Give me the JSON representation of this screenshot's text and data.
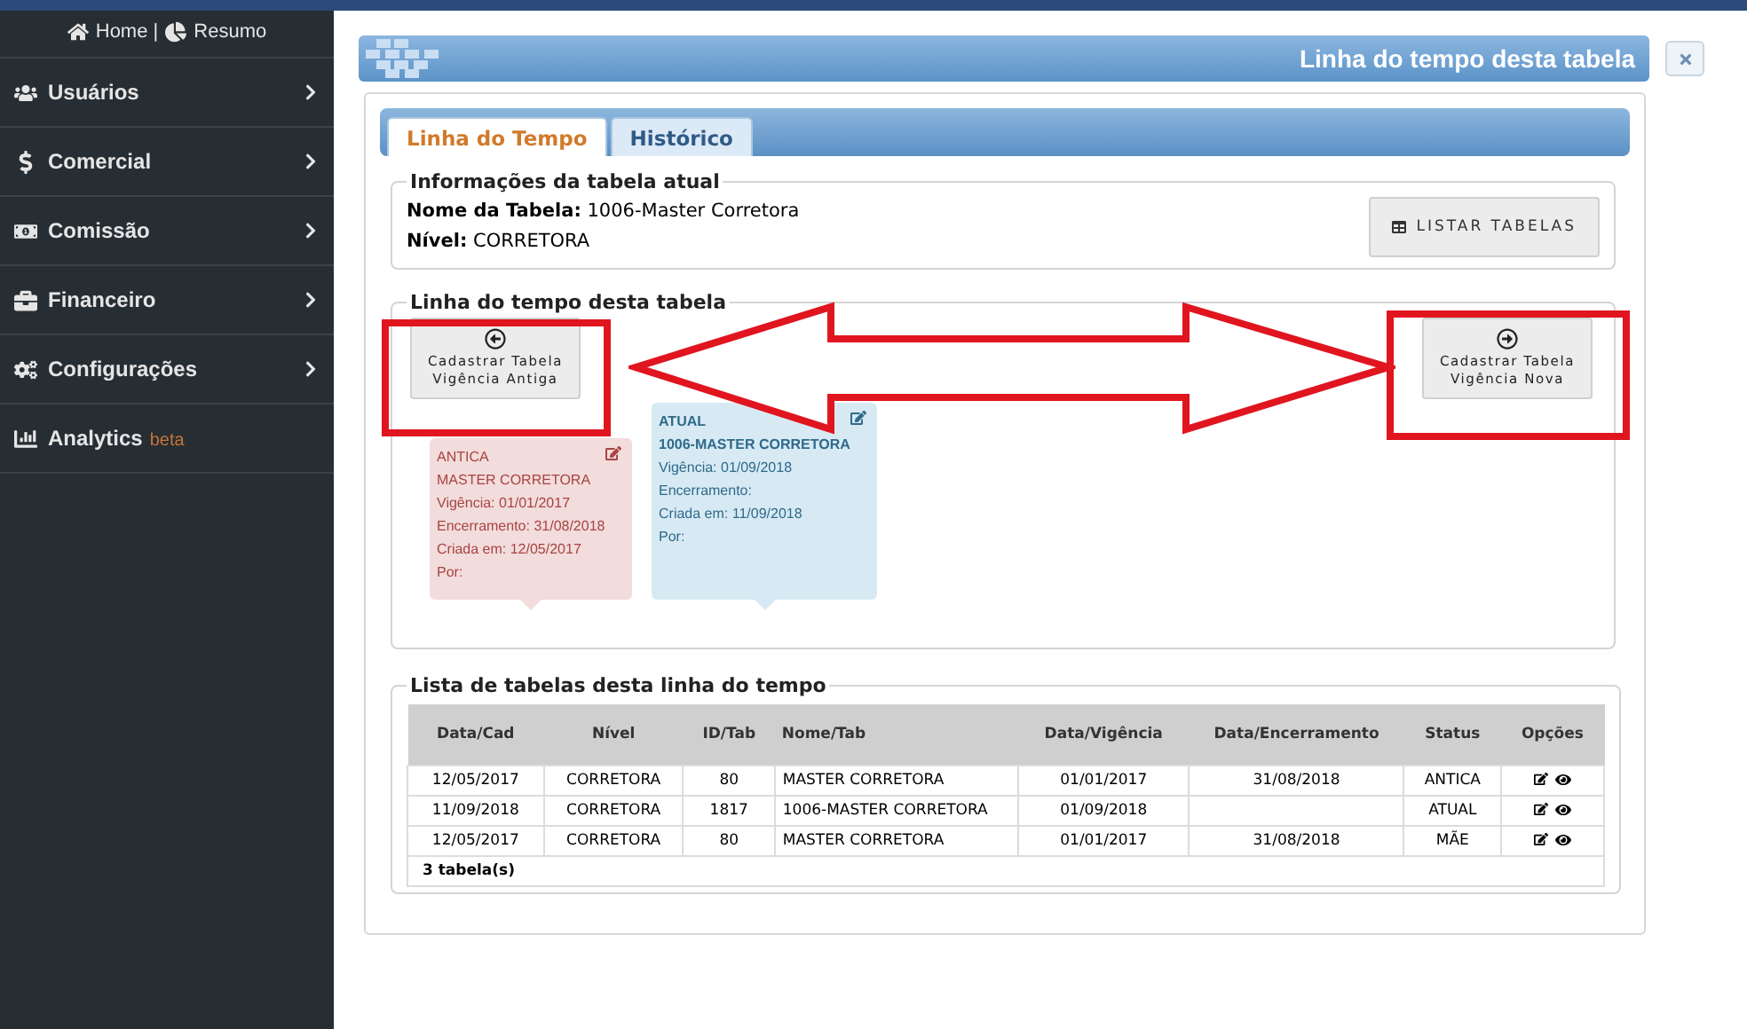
{
  "sidebar": {
    "header": {
      "home": "Home |",
      "summary": "Resumo"
    },
    "items": [
      {
        "label": "Usuários",
        "expandable": true
      },
      {
        "label": "Comercial",
        "expandable": true
      },
      {
        "label": "Comissão",
        "expandable": true
      },
      {
        "label": "Financeiro",
        "expandable": true
      },
      {
        "label": "Configurações",
        "expandable": true
      },
      {
        "label": "Analytics",
        "badge": "beta",
        "expandable": false
      }
    ]
  },
  "dialog": {
    "title": "Linha do tempo desta tabela",
    "tabs": [
      {
        "label": "Linha do Tempo",
        "selected": true
      },
      {
        "label": "Histórico",
        "selected": false
      }
    ],
    "info": {
      "legend": "Informações da tabela atual",
      "fields": [
        {
          "label": "Nome da Tabela:",
          "value": "1006-Master Corretora"
        },
        {
          "label": "Nível:",
          "value": "CORRETORA"
        }
      ],
      "button": "LISTAR TABELAS"
    },
    "timeline": {
      "legend": "Linha do tempo desta tabela",
      "button_old": "Cadastrar Tabela Vigência Antiga",
      "button_new": "Cadastrar Tabela Vigência Nova",
      "cards": [
        {
          "kind": "antiga",
          "lines": [
            "ANTICA",
            "MASTER CORRETORA",
            "Vigência: 01/01/2017",
            "Encerramento: 31/08/2018",
            "Criada em: 12/05/2017",
            "Por:"
          ]
        },
        {
          "kind": "atual",
          "lines": [
            "ATUAL",
            "1006-MASTER CORRETORA",
            "Vigência: 01/09/2018",
            "Encerramento:",
            "Criada em: 11/09/2018",
            "Por:"
          ]
        }
      ]
    },
    "list": {
      "legend": "Lista de tabelas desta linha do tempo",
      "columns": [
        "Data/Cad",
        "Nível",
        "ID/Tab",
        "Nome/Tab",
        "Data/Vigência",
        "Data/Encerramento",
        "Status",
        "Opções"
      ],
      "rows": [
        [
          "12/05/2017",
          "CORRETORA",
          "80",
          "MASTER CORRETORA",
          "01/01/2017",
          "31/08/2018",
          "ANTICA"
        ],
        [
          "11/09/2018",
          "CORRETORA",
          "1817",
          "1006-MASTER CORRETORA",
          "01/09/2018",
          "",
          "ATUAL"
        ],
        [
          "12/05/2017",
          "CORRETORA",
          "80",
          "MASTER CORRETORA",
          "01/01/2017",
          "31/08/2018",
          "MÃE"
        ]
      ],
      "footer": "3 tabela(s)"
    }
  }
}
